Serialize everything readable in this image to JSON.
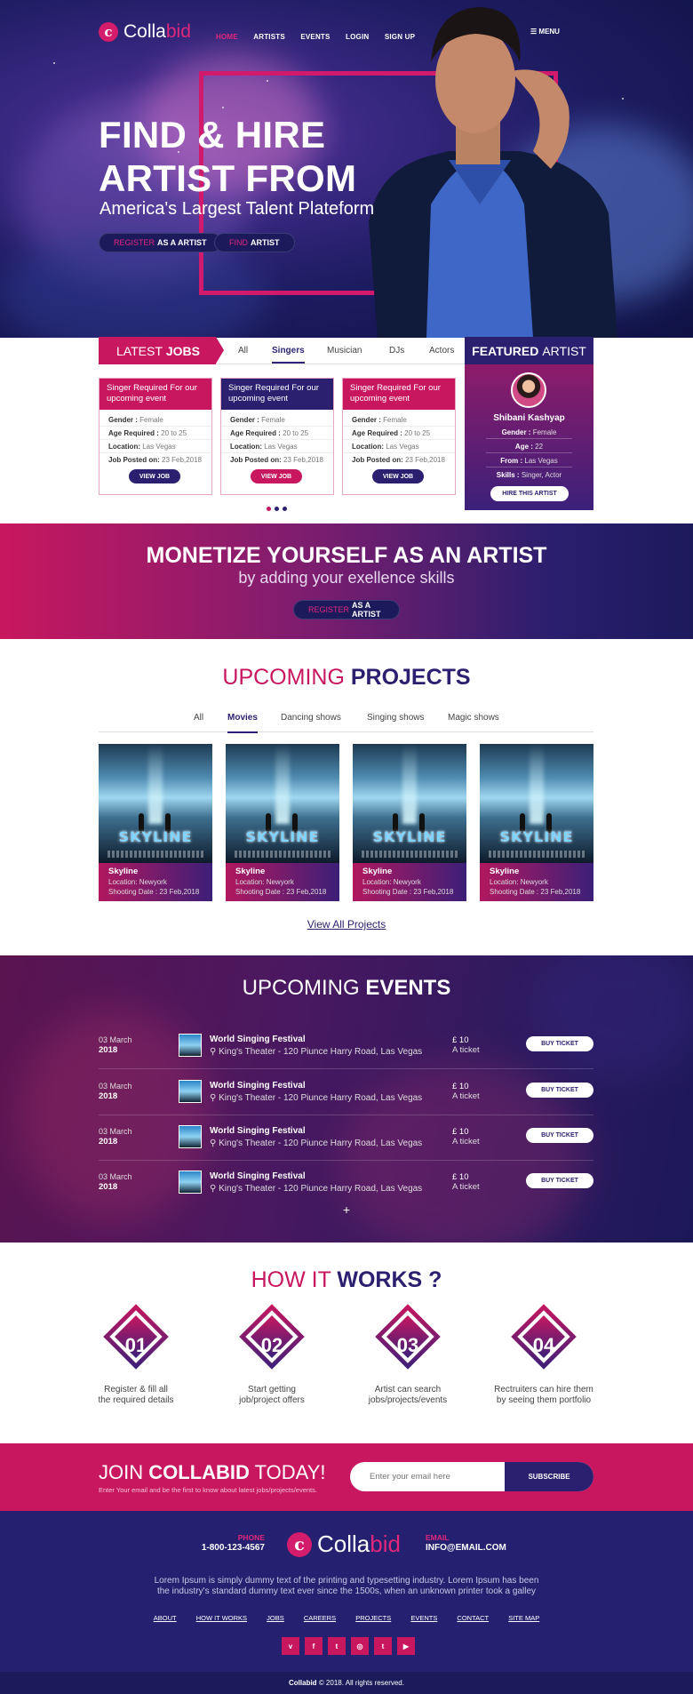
{
  "brand": {
    "name_a": "Colla",
    "name_b": "bid",
    "mark": "c"
  },
  "nav": {
    "items": [
      "HOME",
      "ARTISTS",
      "EVENTS",
      "LOGIN",
      "SIGN UP"
    ],
    "menu": "MENU"
  },
  "hero": {
    "line1": "FIND & HIRE",
    "line2": "ARTIST FROM",
    "subtitle": "America's Largest Talent Plateform",
    "btn1_a": "REGISTER",
    "btn1_b": "AS A ARTIST",
    "btn2_a": "FIND",
    "btn2_b": "ARTIST"
  },
  "latest_jobs": {
    "title_a": "LATEST",
    "title_b": "JOBS",
    "tabs": [
      "All",
      "Singers",
      "Musician",
      "DJs",
      "Actors"
    ],
    "active_tab": "Singers",
    "cards": [
      {
        "title": "Singer Required For our upcoming event",
        "gender_k": "Gender :",
        "gender": "Female",
        "age_k": "Age Required :",
        "age": "20 to 25",
        "loc_k": "Location:",
        "loc": "Las Vegas",
        "posted_k": "Job Posted on:",
        "posted": "23 Feb,2018",
        "button": "VIEW JOB",
        "color": "#c8175f"
      },
      {
        "title": "Singer Required For our upcoming event",
        "gender_k": "Gender :",
        "gender": "Female",
        "age_k": "Age Required :",
        "age": "20 to 25",
        "loc_k": "Location:",
        "loc": "Las Vegas",
        "posted_k": "Job Posted on:",
        "posted": "23 Feb,2018",
        "button": "VIEW JOB",
        "color": "#2b1f70"
      },
      {
        "title": "Singer Required For our upcoming event",
        "gender_k": "Gender :",
        "gender": "Female",
        "age_k": "Age Required :",
        "age": "20 to 25",
        "loc_k": "Location:",
        "loc": "Las Vegas",
        "posted_k": "Job Posted on:",
        "posted": "23 Feb,2018",
        "button": "VIEW JOB",
        "color": "#c8175f"
      }
    ]
  },
  "featured": {
    "title_a": "FEATURED",
    "title_b": "ARTIST",
    "name": "Shibani Kashyap",
    "gender_k": "Gender :",
    "gender": "Female",
    "age_k": "Age :",
    "age": "22",
    "from_k": "From :",
    "from": "Las Vegas",
    "skills_k": "Skills :",
    "skills": "Singer, Actor",
    "button": "HIRE THIS ARTIST"
  },
  "monetize": {
    "title": "MONETIZE YOURSELF AS AN ARTIST",
    "subtitle": "by adding your exellence skills",
    "btn_a": "REGISTER",
    "btn_b": "AS A ARTIST"
  },
  "projects": {
    "title_a": "UPCOMING",
    "title_b": "PROJECTS",
    "tabs": [
      "All",
      "Movies",
      "Dancing shows",
      "Singing shows",
      "Magic shows"
    ],
    "active_tab": "Movies",
    "items": [
      {
        "poster_title": "SKYLINE",
        "poster_tag": "DON'T LOOK UP",
        "name": "Skyline",
        "loc_k": "Location:",
        "loc": "Newyork",
        "date_k": "Shooting Date :",
        "date": "23 Feb,2018"
      },
      {
        "poster_title": "SKYLINE",
        "poster_tag": "DON'T LOOK UP",
        "name": "Skyline",
        "loc_k": "Location:",
        "loc": "Newyork",
        "date_k": "Shooting Date :",
        "date": "23 Feb,2018"
      },
      {
        "poster_title": "SKYLINE",
        "poster_tag": "DON'T LOOK UP",
        "name": "Skyline",
        "loc_k": "Location:",
        "loc": "Newyork",
        "date_k": "Shooting Date :",
        "date": "23 Feb,2018"
      },
      {
        "poster_title": "SKYLINE",
        "poster_tag": "DON'T LOOK UP",
        "name": "Skyline",
        "loc_k": "Location:",
        "loc": "Newyork",
        "date_k": "Shooting Date :",
        "date": "23 Feb,2018"
      }
    ],
    "view_all": "View All Projects"
  },
  "events": {
    "title_a": "UPCOMING",
    "title_b": "EVENTS",
    "rows": [
      {
        "day": "03 March",
        "year": "2018",
        "name": "World Singing Festival",
        "place": "King's Theater - 120 Piunce Harry Road, Las Vegas",
        "price": "£ 10",
        "unit": "A ticket",
        "button": "BUY TICKET"
      },
      {
        "day": "03 March",
        "year": "2018",
        "name": "World Singing Festival",
        "place": "King's Theater - 120 Piunce Harry Road, Las Vegas",
        "price": "£ 10",
        "unit": "A ticket",
        "button": "BUY TICKET"
      },
      {
        "day": "03 March",
        "year": "2018",
        "name": "World Singing Festival",
        "place": "King's Theater - 120 Piunce Harry Road, Las Vegas",
        "price": "£ 10",
        "unit": "A ticket",
        "button": "BUY TICKET"
      },
      {
        "day": "03 March",
        "year": "2018",
        "name": "World Singing Festival",
        "place": "King's Theater - 120 Piunce Harry Road, Las Vegas",
        "price": "£ 10",
        "unit": "A ticket",
        "button": "BUY TICKET"
      }
    ],
    "more": "+"
  },
  "how": {
    "title_a": "HOW IT",
    "title_b": "WORKS ?",
    "steps": [
      {
        "num": "01",
        "l1": "Register & fill all",
        "l2": "the required details"
      },
      {
        "num": "02",
        "l1": "Start getting",
        "l2": "job/project offers"
      },
      {
        "num": "03",
        "l1": "Artist can search",
        "l2": "jobs/projects/events"
      },
      {
        "num": "04",
        "l1": "Rectruiters can hire them",
        "l2": "by seeing them portfolio"
      }
    ]
  },
  "join": {
    "title_a": "JOIN",
    "title_b": "COLLABID",
    "title_c": "TODAY!",
    "sub": "Enter Your email and be the first to know about latest jobs/projects/events.",
    "placeholder": "Enter your email here",
    "button": "SUBSCRIBE"
  },
  "footer": {
    "phone_k": "PHONE",
    "phone": "1-800-123-4567",
    "email_k": "EMAIL",
    "email": "INFO@EMAIL.COM",
    "text1": "Lorem Ipsum is simply dummy text of the printing and typesetting industry. Lorem Ipsum has been",
    "text2": "the industry's standard dummy text ever since the 1500s, when an unknown printer took a galley",
    "links": [
      "ABOUT",
      "HOW IT WORKS",
      "JOBS",
      "CAREERS",
      "PROJECTS",
      "EVENTS",
      "CONTACT",
      "SITE MAP"
    ],
    "social": [
      "vimeo-icon",
      "facebook-icon",
      "twitter-icon",
      "instagram-icon",
      "tumblr-icon",
      "youtube-icon"
    ],
    "copy_a": "Collabid",
    "copy_b": "© 2018. All rights reserved."
  }
}
